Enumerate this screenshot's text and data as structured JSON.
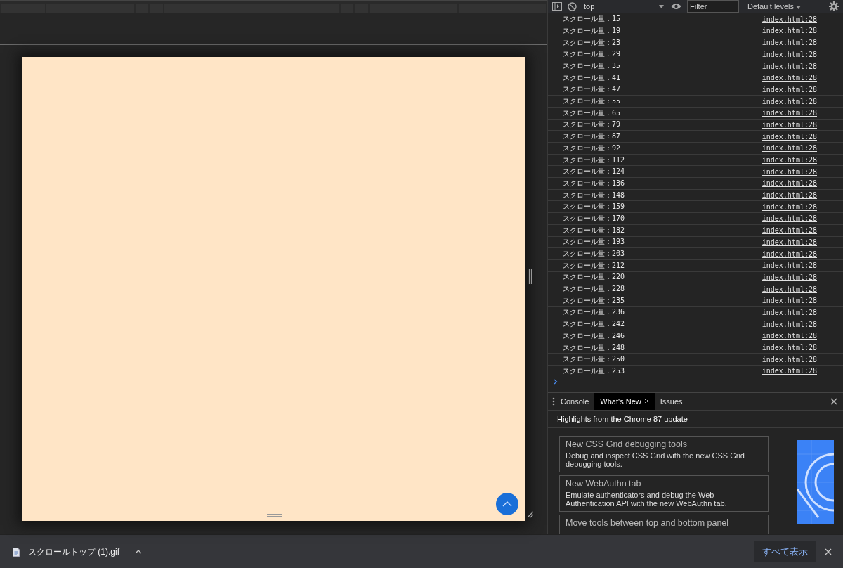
{
  "console_toolbar": {
    "context": "top",
    "filter_placeholder": "Filter",
    "levels": "Default levels"
  },
  "logs": [
    {
      "message": "スクロール量：15",
      "source": "index.html:28"
    },
    {
      "message": "スクロール量：19",
      "source": "index.html:28"
    },
    {
      "message": "スクロール量：23",
      "source": "index.html:28"
    },
    {
      "message": "スクロール量：29",
      "source": "index.html:28"
    },
    {
      "message": "スクロール量：35",
      "source": "index.html:28"
    },
    {
      "message": "スクロール量：41",
      "source": "index.html:28"
    },
    {
      "message": "スクロール量：47",
      "source": "index.html:28"
    },
    {
      "message": "スクロール量：55",
      "source": "index.html:28"
    },
    {
      "message": "スクロール量：65",
      "source": "index.html:28"
    },
    {
      "message": "スクロール量：79",
      "source": "index.html:28"
    },
    {
      "message": "スクロール量：87",
      "source": "index.html:28"
    },
    {
      "message": "スクロール量：92",
      "source": "index.html:28"
    },
    {
      "message": "スクロール量：112",
      "source": "index.html:28"
    },
    {
      "message": "スクロール量：124",
      "source": "index.html:28"
    },
    {
      "message": "スクロール量：136",
      "source": "index.html:28"
    },
    {
      "message": "スクロール量：148",
      "source": "index.html:28"
    },
    {
      "message": "スクロール量：159",
      "source": "index.html:28"
    },
    {
      "message": "スクロール量：170",
      "source": "index.html:28"
    },
    {
      "message": "スクロール量：182",
      "source": "index.html:28"
    },
    {
      "message": "スクロール量：193",
      "source": "index.html:28"
    },
    {
      "message": "スクロール量：203",
      "source": "index.html:28"
    },
    {
      "message": "スクロール量：212",
      "source": "index.html:28"
    },
    {
      "message": "スクロール量：220",
      "source": "index.html:28"
    },
    {
      "message": "スクロール量：228",
      "source": "index.html:28"
    },
    {
      "message": "スクロール量：235",
      "source": "index.html:28"
    },
    {
      "message": "スクロール量：236",
      "source": "index.html:28"
    },
    {
      "message": "スクロール量：242",
      "source": "index.html:28"
    },
    {
      "message": "スクロール量：246",
      "source": "index.html:28"
    },
    {
      "message": "スクロール量：248",
      "source": "index.html:28"
    },
    {
      "message": "スクロール量：250",
      "source": "index.html:28"
    },
    {
      "message": "スクロール量：253",
      "source": "index.html:28"
    }
  ],
  "drawer_tabs": [
    {
      "label": "Console",
      "selected": false,
      "closable": false
    },
    {
      "label": "What's New",
      "selected": true,
      "closable": true
    },
    {
      "label": "Issues",
      "selected": false,
      "closable": false
    }
  ],
  "whats_new": {
    "heading": "Highlights from the Chrome 87 update",
    "cards": [
      {
        "title": "New CSS Grid debugging tools",
        "description": "Debug and inspect CSS Grid with the new CSS Grid debugging tools."
      },
      {
        "title": "New WebAuthn tab",
        "description": "Emulate authenticators and debug the Web Authentication API with the new WebAuthn tab."
      },
      {
        "title": "Move tools between top and bottom panel"
      }
    ]
  },
  "download_bar": {
    "filename": "スクロールトップ (1).gif",
    "show_all": "すべて表示"
  }
}
